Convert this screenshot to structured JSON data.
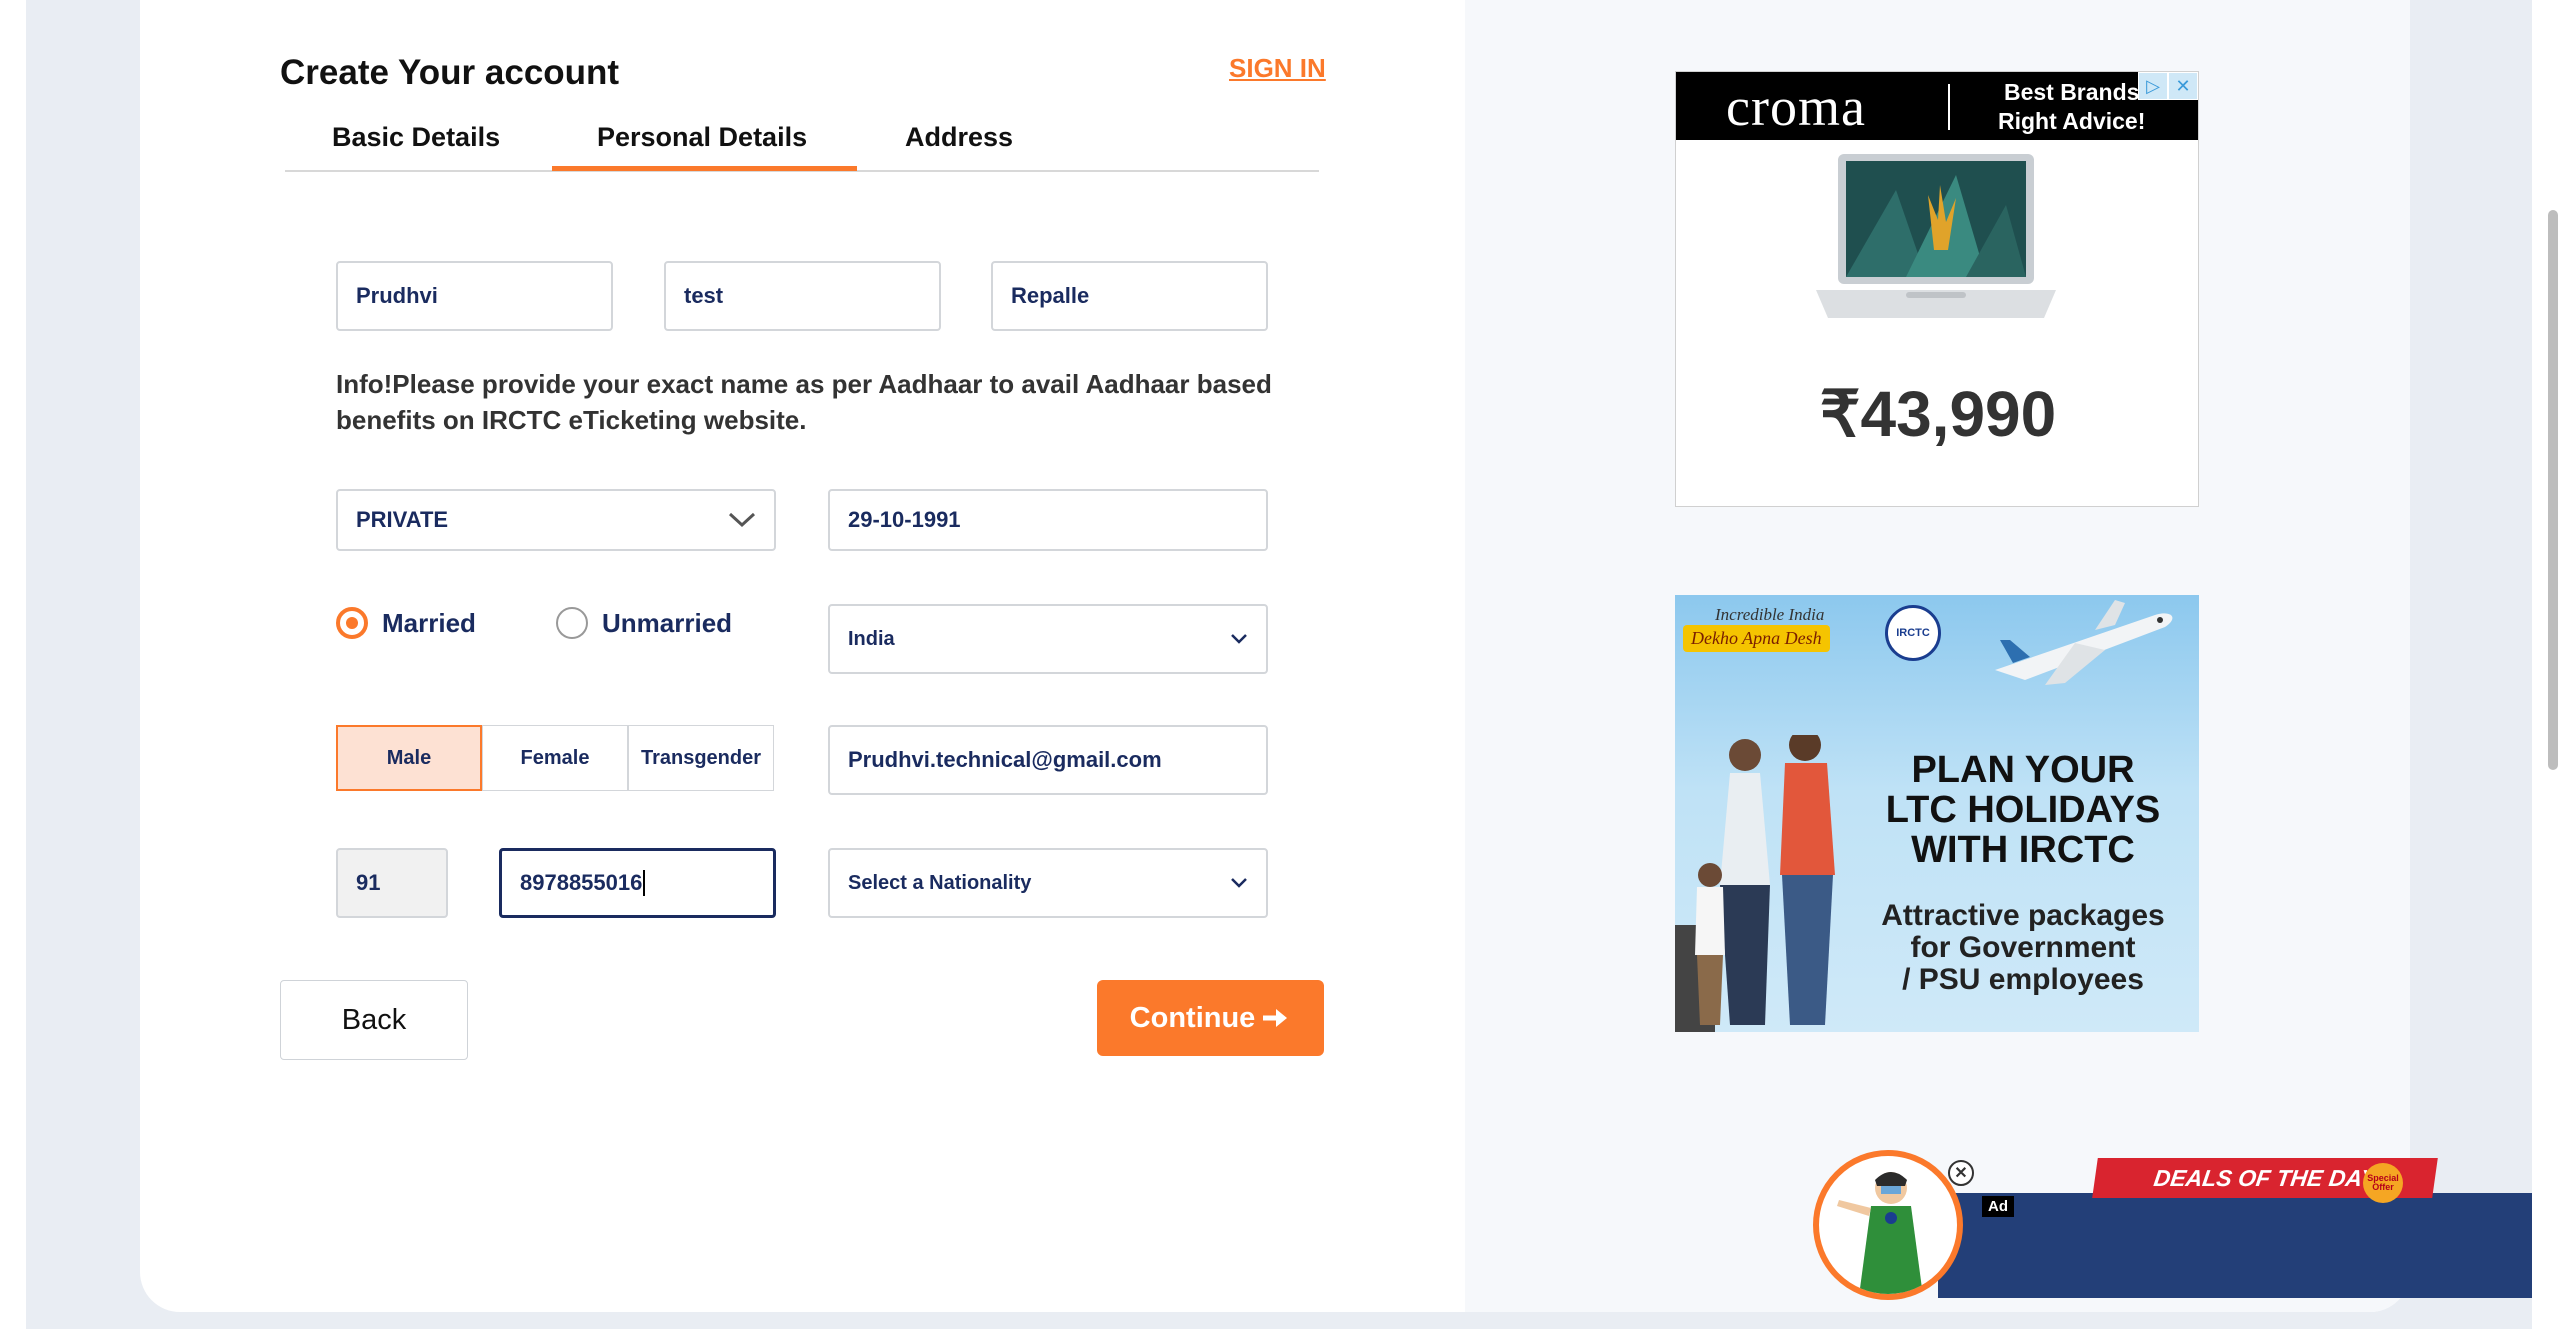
{
  "form": {
    "title": "Create Your account",
    "signin": "SIGN IN",
    "tabs": [
      {
        "label": "Basic Details"
      },
      {
        "label": "Personal Details"
      },
      {
        "label": "Address"
      }
    ],
    "active_tab": "Personal Details",
    "first_name": "Prudhvi",
    "middle_name": "test",
    "last_name": "Repalle",
    "info": "Info!Please provide your exact name as per Aadhaar to avail Aadhaar based benefits on IRCTC eTicketing website.",
    "occupation": "PRIVATE",
    "dob": "29-10-1991",
    "marital": {
      "married": "Married",
      "unmarried": "Unmarried",
      "selected": "Married"
    },
    "country": "India",
    "gender": {
      "male": "Male",
      "female": "Female",
      "transgender": "Transgender",
      "selected": "Male"
    },
    "email": "Prudhvi.technical@gmail.com",
    "isd_code": "91",
    "mobile": "8978855016",
    "nationality": "Select a Nationality",
    "back": "Back",
    "continue": "Continue"
  },
  "ads": {
    "croma": {
      "brand": "croma",
      "tagline_line1": "Best Brands",
      "tagline_line2": "Right Advice!",
      "price": "₹43,990"
    },
    "irctc": {
      "incredible": "Incredible India",
      "dekho": "Dekho Apna Desh",
      "badge": "IRCTC",
      "headline_line1": "PLAN YOUR",
      "headline_line2": "LTC HOLIDAYS",
      "headline_line3": "WITH IRCTC",
      "sub_line1": "Attractive packages",
      "sub_line2": "for Government",
      "sub_line3": "/ PSU employees"
    },
    "deals": "DEALS OF THE DAY",
    "special": "Special Offer",
    "ad_label": "Ad"
  },
  "colors": {
    "accent": "#fb792b",
    "navy": "#1a2b5f",
    "banner_blue": "#233f78"
  }
}
